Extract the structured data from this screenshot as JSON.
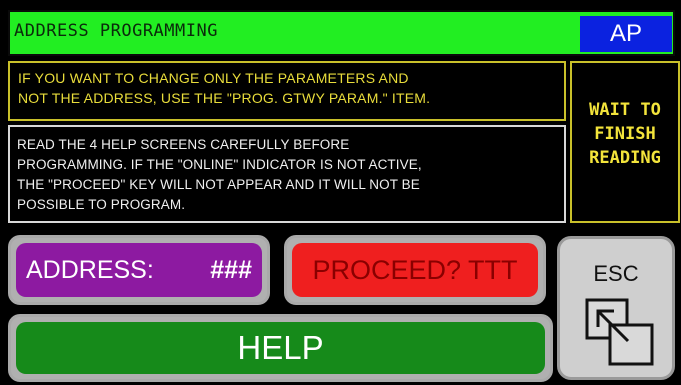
{
  "header": {
    "title": "ADDRESS PROGRAMMING",
    "badge": "AP",
    "accent_color": "#22ee22",
    "badge_color": "#0b22e0"
  },
  "notice": {
    "line1": "IF YOU WANT TO CHANGE ONLY THE PARAMETERS AND",
    "line2": "NOT THE ADDRESS, USE THE \"PROG. GTWY PARAM.\" ITEM."
  },
  "wait_panel": {
    "line1": "WAIT TO",
    "line2": "FINISH",
    "line3": "READING"
  },
  "info": {
    "line1": "READ THE 4 HELP SCREENS CAREFULLY BEFORE",
    "line2": "PROGRAMMING. IF THE \"ONLINE\" INDICATOR IS NOT ACTIVE,",
    "line3": "THE \"PROCEED\" KEY WILL NOT APPEAR AND IT WILL NOT BE",
    "line4": "POSSIBLE TO PROGRAM."
  },
  "buttons": {
    "address_label": "ADDRESS:",
    "address_value": "###",
    "proceed_label": "PROCEED? TTT",
    "help_label": "HELP",
    "esc_label": "ESC",
    "esc_icon": "window-restore-icon"
  },
  "colors": {
    "address": "#8d1aa1",
    "proceed": "#ef1f1f",
    "help": "#168a1a"
  }
}
